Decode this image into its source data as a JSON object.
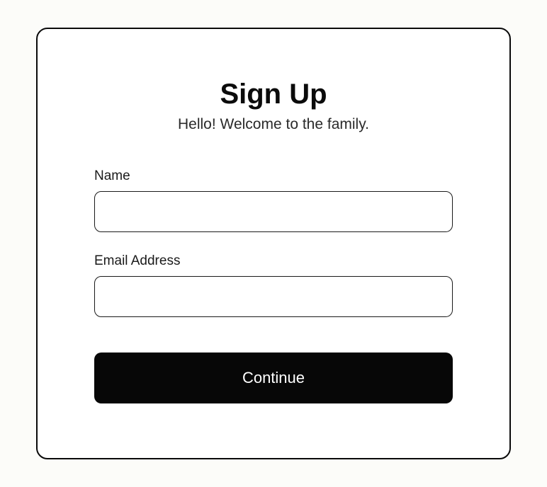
{
  "header": {
    "title": "Sign Up",
    "subtitle": "Hello! Welcome to the family."
  },
  "form": {
    "name": {
      "label": "Name",
      "value": ""
    },
    "email": {
      "label": "Email Address",
      "value": ""
    },
    "submit_label": "Continue"
  }
}
